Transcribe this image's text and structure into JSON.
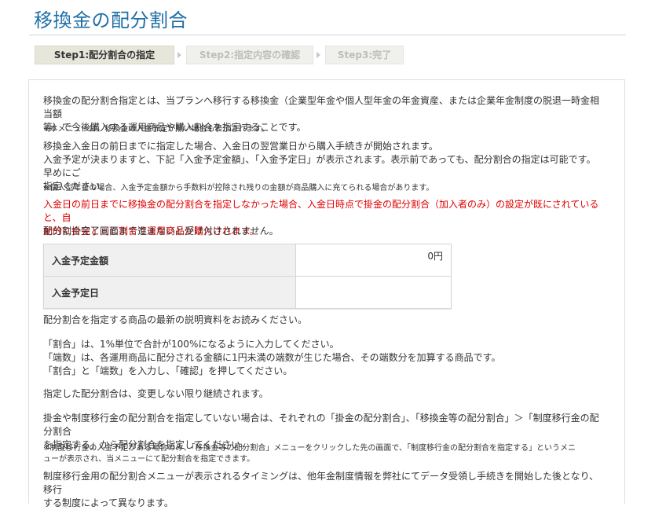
{
  "page": {
    "title": "移換金の配分割合"
  },
  "steps": [
    {
      "label": "Step1:配分割合の指定",
      "state": "active"
    },
    {
      "label": "Step2:指定内容の確認",
      "state": "inactive"
    },
    {
      "label": "Step3:完了",
      "state": "inactive"
    }
  ],
  "intro": {
    "line1": "移換金の配分割合指定とは、当プランへ移行する移換金（企業型年金や個人型年金の年金資産、または企業年金制度の脱退一時金相当額",
    "line2": "等）で今後購入する運用商品や購入割合を指定することです。",
    "note1": "※本メニューは、移換金の入金予定が無い場合も表示されます。",
    "p2_line1": "移換金入金日の前日までに指定した場合、入金日の翌営業日から購入手続きが開始されます。",
    "p2_line2": "入金予定が決まりますと、下記「入金予定金額」、「入金予定日」が表示されます。表示前であっても、配分割合の指定は可能です。早めにご",
    "p2_line3": "指定ください。",
    "note2": "※個人型年金の場合、入金予定金額から手数料が控除され残りの金額が商品購入に充てられる場合があります。",
    "red_line1": "入金日の前日までに移換金の配分割合を指定しなかった場合、入金日時点で掛金の配分割合（加入者のみ）の設定が既にされていると、自",
    "red_line2": "動的に掛金と同じ割合で運用商品が購入されます。",
    "p3": "配分割合完了画面まで進まないと受け付けされません。"
  },
  "amount_table": {
    "rows": [
      {
        "label": "入金予定金額",
        "value": "0円"
      },
      {
        "label": "入金予定日",
        "value": ""
      }
    ]
  },
  "instructions": {
    "read_docs": "配分割合を指定する商品の最新の説明資料をお読みください。",
    "ratio_line1": "「割合」は、1%単位で合計が100%になるように入力してください。",
    "ratio_line2": "「端数」は、各運用商品に配分される金額に1円未満の端数が生じた場合、その端数分を加算する商品です。",
    "ratio_line3": "「割合」と「端数」を入力し、「確認」を押してください。",
    "continue": "指定した配分割合は、変更しない限り継続されます。",
    "other_line1": "掛金や制度移行金の配分割合を指定していない場合は、それぞれの「掛金の配分割合」、「移換金等の配分割合」＞「制度移行金の配分割合",
    "other_line2": "を指定する」から配分割合を指定してください。",
    "note3_line1": "※制度移行金の入金予定がある場合のみ、「移換金等の配分割合」メニューをクリックした先の画面で、「制度移行金の配分割合を指定する」というメニ",
    "note3_line2": "ューが表示され、当メニューにて配分割合を指定できます。",
    "timing_line1": "制度移行金用の配分割合メニューが表示されるタイミングは、他年金制度情報を弊社にてデータ受領し手続きを開始した後となり、移行",
    "timing_line2": "する制度によって異なります。"
  },
  "colors": {
    "title": "#1f6fa6",
    "warning": "#e00000",
    "step_active_bg": "#e7e6da"
  }
}
